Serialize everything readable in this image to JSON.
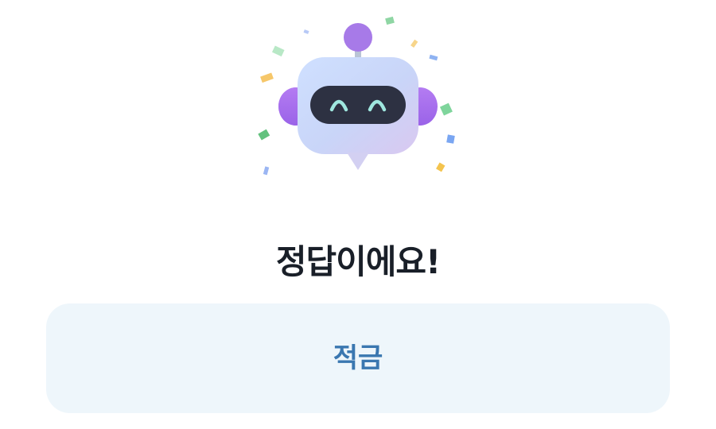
{
  "illustration": {
    "icon": "robot-icon",
    "colors": {
      "face_light": "#c7d7ff",
      "face_dark": "#d6c9f2",
      "ear": "#a771ec",
      "antenna_ball": "#a77ae8",
      "visor": "#2d3142",
      "eyes": "#9fe7df"
    }
  },
  "result": {
    "title": "정답이에요!"
  },
  "answer": {
    "label": "적금",
    "background": "#eef6fb",
    "text_color": "#3a77b0"
  }
}
